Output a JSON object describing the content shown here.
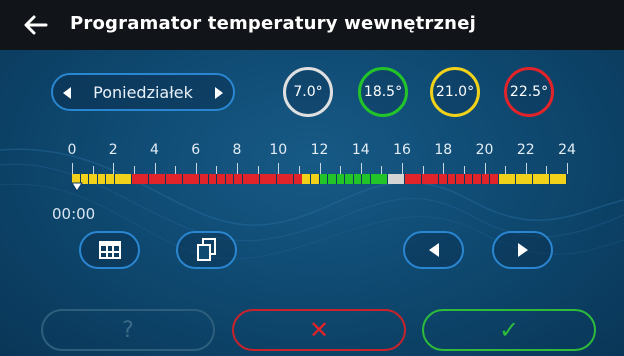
{
  "header": {
    "title": "Programator temperatury wewnętrznej"
  },
  "day_selector": {
    "label": "Poniedziałek"
  },
  "temperatures": [
    {
      "label": "7.0°",
      "color": "#e0e0e0"
    },
    {
      "label": "18.5°",
      "color": "#22c42a"
    },
    {
      "label": "21.0°",
      "color": "#f2d11a"
    },
    {
      "label": "22.5°",
      "color": "#e0242a"
    }
  ],
  "timeline": {
    "hour_labels": [
      "0",
      "2",
      "4",
      "6",
      "8",
      "10",
      "12",
      "14",
      "16",
      "18",
      "20",
      "22",
      "24"
    ],
    "schedule": [
      "yellow",
      "yellow",
      "yellow",
      "yellow",
      "yellow",
      "yellow",
      "yellow",
      "red",
      "red",
      "red",
      "red",
      "red",
      "red",
      "red",
      "red",
      "red",
      "red",
      "red",
      "red",
      "red",
      "red",
      "red",
      "red",
      "red",
      "red",
      "red",
      "red",
      "yellow",
      "yellow",
      "green",
      "green",
      "green",
      "green",
      "green",
      "green",
      "green",
      "green",
      "gray",
      "gray",
      "red",
      "red",
      "red",
      "red",
      "red",
      "red",
      "red",
      "red",
      "red",
      "red",
      "red",
      "yellow",
      "yellow",
      "yellow",
      "yellow",
      "yellow",
      "yellow",
      "yellow",
      "yellow"
    ],
    "current_time": "00:00"
  },
  "colors": {
    "yellow": "#f2d11a",
    "red": "#e0242a",
    "green": "#22c42a",
    "gray": "#d4d4d4",
    "accent": "#2a86d0"
  },
  "buttons": {
    "help_label": "?",
    "cancel_symbol": "✕",
    "ok_symbol": "✓"
  }
}
